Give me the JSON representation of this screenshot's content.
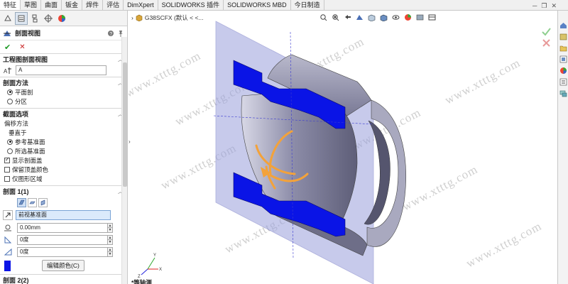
{
  "tabs": [
    "特征",
    "草图",
    "曲面",
    "钣金",
    "焊件",
    "评估",
    "DimXpert",
    "SOLIDWORKS 插件",
    "SOLIDWORKS MBD",
    "今日制造"
  ],
  "panel": {
    "title": "剖面视图",
    "sections": {
      "view": {
        "title": "工程图剖面视图",
        "name_value": "A"
      },
      "method": {
        "title": "剖面方法",
        "options": [
          "平面剖",
          "分区"
        ],
        "selected": 0
      },
      "options": {
        "title": "截面选项",
        "offset_label": "偏移方法",
        "normal_label": "垂直于",
        "radio": [
          "参考基准面",
          "所选基准面"
        ],
        "selected": 0,
        "checks": [
          {
            "label": "显示剖面盖",
            "checked": true
          },
          {
            "label": "保留顶盖颜色",
            "checked": false
          },
          {
            "label": "仅图形区域",
            "checked": false
          }
        ]
      },
      "section1": {
        "title": "剖面 1(1)",
        "plane": "前视基准面",
        "offset": "0.00mm",
        "angle1": "0度",
        "angle2": "0度",
        "edit_color": "编辑颜色(C)",
        "cap_color": "#0a14e6"
      },
      "section2": {
        "title": "剖面 2(2)"
      }
    }
  },
  "viewport": {
    "doc_title": "G38SCFX (默认 < <...",
    "view_label": "*等轴测",
    "cap_color": "#0a14e6",
    "plane_color": "#9aa0dc"
  },
  "watermark": "www.xtttg.com"
}
